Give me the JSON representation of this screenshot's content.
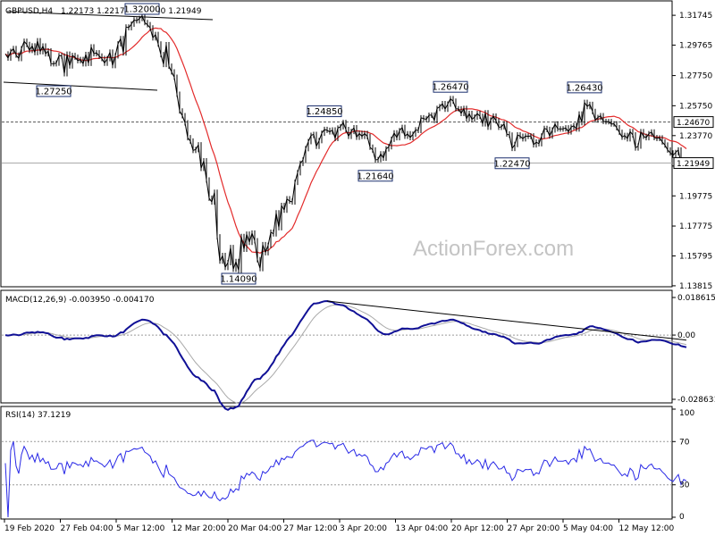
{
  "chart_data": {
    "type": "line",
    "symbol": "GBPUSD,H4",
    "ohlc_header": "1.22173 1.22177 1.21930 1.21949",
    "price_axis_ticks": [
      "1.31745",
      "1.29765",
      "1.27750",
      "1.25750",
      "1.23770",
      "1.21755",
      "1.19775",
      "1.17775",
      "1.15795",
      "1.13815"
    ],
    "price_range": [
      1.1381,
      1.3264
    ],
    "current_price": "1.21949",
    "reference_level": "1.24670",
    "x_tick_labels": [
      "19 Feb 2020",
      "27 Feb 04:00",
      "5 Mar 12:00",
      "12 Mar 20:00",
      "20 Mar 04:00",
      "27 Mar 12:00",
      "3 Apr 20:00",
      "13 Apr 04:00",
      "20 Apr 12:00",
      "27 Apr 20:00",
      "5 May 04:00",
      "12 May 12:00"
    ],
    "price_annotations": [
      "1.32000",
      "1.27250",
      "1.24850",
      "1.14090",
      "1.21640",
      "1.26470",
      "1.22470",
      "1.26430"
    ],
    "price_series": {
      "name": "GBPUSD",
      "x": [
        0,
        3,
        6,
        9,
        12,
        15,
        18,
        21,
        24,
        26,
        29,
        31,
        34,
        37,
        40,
        43,
        46,
        49,
        52,
        55,
        58,
        61,
        64,
        66,
        69,
        72,
        75,
        78,
        81,
        84,
        87,
        90,
        93,
        96,
        99,
        102,
        105,
        108,
        111,
        114,
        117,
        120,
        123,
        126,
        129,
        132,
        135,
        138,
        141,
        144,
        147,
        150,
        153,
        156,
        159,
        162,
        165,
        168,
        171,
        174,
        177,
        180,
        183,
        186,
        189,
        192,
        195,
        198,
        201,
        204,
        207,
        210,
        213,
        216,
        219,
        222,
        225,
        228,
        231,
        234,
        237,
        240,
        243,
        246,
        249,
        252,
        255,
        258,
        261,
        264,
        267,
        270,
        273,
        276,
        279,
        282,
        285,
        288,
        291,
        294,
        297,
        300,
        303,
        306,
        309,
        312,
        315,
        318,
        321,
        324,
        327,
        330,
        333,
        336,
        339,
        342,
        345,
        348,
        351,
        354,
        357,
        360,
        363,
        366,
        369,
        372,
        375,
        378,
        381,
        384,
        387,
        390,
        393,
        396,
        399,
        402,
        405,
        408,
        411,
        414,
        417,
        420,
        423,
        426,
        429,
        432,
        435,
        438,
        441,
        444,
        447,
        450,
        453,
        456,
        459,
        462,
        465,
        468,
        471,
        474,
        477,
        480,
        483,
        486,
        489,
        492,
        495,
        498,
        501,
        504,
        507,
        510,
        513,
        516,
        519,
        522,
        525,
        528,
        531,
        534,
        537,
        540,
        543,
        546,
        549,
        552,
        555,
        558,
        561,
        564,
        567,
        570,
        573,
        576,
        579,
        582,
        585,
        588,
        591,
        594,
        597,
        600,
        603,
        606,
        609,
        612,
        615,
        618,
        621,
        624,
        627,
        630,
        633,
        636,
        639,
        642,
        645,
        648,
        651,
        654,
        657,
        660,
        663,
        666,
        669,
        672,
        675,
        678,
        681,
        684,
        687,
        690,
        693,
        696,
        699,
        702,
        705,
        708,
        711,
        714,
        717,
        720,
        723,
        726,
        729,
        732,
        735,
        738,
        741
      ],
      "y": [
        1.2918,
        1.2891,
        1.2935,
        1.2954,
        1.2911,
        1.2888,
        1.2953,
        1.3002,
        1.2981,
        1.2942,
        1.2972,
        1.2927,
        1.3006,
        1.2933,
        1.2971,
        1.2919,
        1.2938,
        1.2854,
        1.2853,
        1.2858,
        1.2907,
        1.2905,
        1.2787,
        1.2917,
        1.2839,
        1.2908,
        1.2896,
        1.2874,
        1.2881,
        1.2853,
        1.2915,
        1.2856,
        1.2965,
        1.292,
        1.2926,
        1.2904,
        1.2888,
        1.2857,
        1.2887,
        1.293,
        1.2841,
        1.2906,
        1.2985,
        1.302,
        1.2925,
        1.3097,
        1.3092,
        1.3116,
        1.3144,
        1.3138,
        1.3153,
        1.3171,
        1.3126,
        1.3112,
        1.3091,
        1.3025,
        1.3047,
        1.2984,
        1.2914,
        1.2849,
        1.298,
        1.2837,
        1.2799,
        1.2764,
        1.2651,
        1.254,
        1.2509,
        1.2462,
        1.2363,
        1.2341,
        1.2279,
        1.2285,
        1.2316,
        1.216,
        1.221,
        1.2083,
        1.1962,
        1.1937,
        1.2001,
        1.1706,
        1.1545,
        1.1582,
        1.1503,
        1.1535,
        1.1635,
        1.1491,
        1.1542,
        1.1484,
        1.1708,
        1.1624,
        1.1724,
        1.167,
        1.1731,
        1.168,
        1.1555,
        1.1496,
        1.1654,
        1.1601,
        1.165,
        1.1736,
        1.1726,
        1.1865,
        1.1767,
        1.1914,
        1.1883,
        1.1958,
        1.1943,
        1.1937,
        1.2067,
        1.2131,
        1.2193,
        1.2215,
        1.2291,
        1.2337,
        1.2379,
        1.2385,
        1.2306,
        1.2344,
        1.2393,
        1.2418,
        1.2412,
        1.2402,
        1.2414,
        1.2358,
        1.2427,
        1.2436,
        1.2464,
        1.2417,
        1.2372,
        1.2405,
        1.2429,
        1.2366,
        1.2392,
        1.2372,
        1.2391,
        1.2371,
        1.23,
        1.2282,
        1.2216,
        1.2218,
        1.2256,
        1.2228,
        1.2289,
        1.2303,
        1.2353,
        1.2395,
        1.2363,
        1.241,
        1.2431,
        1.2373,
        1.2389,
        1.2364,
        1.2386,
        1.2415,
        1.2411,
        1.2495,
        1.249,
        1.2484,
        1.2512,
        1.2513,
        1.2477,
        1.2557,
        1.2569,
        1.2589,
        1.2552,
        1.2586,
        1.2622,
        1.2605,
        1.2555,
        1.2554,
        1.2524,
        1.2557,
        1.2488,
        1.2524,
        1.2485,
        1.25,
        1.2524,
        1.2505,
        1.2455,
        1.2528,
        1.2433,
        1.248,
        1.2506,
        1.2474,
        1.2432,
        1.2435,
        1.2456,
        1.2388,
        1.238,
        1.2292,
        1.2318,
        1.2382,
        1.2373,
        1.2356,
        1.2374,
        1.2372,
        1.2375,
        1.2316,
        1.2334,
        1.2323,
        1.2374,
        1.2425,
        1.2418,
        1.2374,
        1.2414,
        1.2454,
        1.2422,
        1.2421,
        1.2422,
        1.2428,
        1.2402,
        1.2433,
        1.2443,
        1.2421,
        1.252,
        1.2463,
        1.2597,
        1.257,
        1.2584,
        1.2537,
        1.2481,
        1.2497,
        1.2509,
        1.2471,
        1.2469,
        1.247,
        1.2454,
        1.2455,
        1.2429,
        1.2399,
        1.2367,
        1.2378,
        1.2356,
        1.2404,
        1.2382,
        1.2295,
        1.2308,
        1.2403,
        1.2372,
        1.2363,
        1.239,
        1.2401,
        1.2364,
        1.2358,
        1.2362,
        1.2335,
        1.2314,
        1.2282,
        1.2262,
        1.2247,
        1.2265,
        1.2282,
        1.2182,
        1.2211,
        1.2195
      ]
    },
    "macd_label": "MACD(12,26,9) -0.003950 -0.004170",
    "macd_axis_ticks": [
      "0.018615",
      "0.00",
      "-0.028631"
    ],
    "macd_range": [
      -0.028631,
      0.018615
    ],
    "rsi_label": "RSI(14) 37.1219",
    "rsi_axis_ticks": [
      "100",
      "70",
      "30",
      "0"
    ],
    "rsi_range": [
      0,
      100
    ],
    "rsi_levels": [
      30,
      70
    ],
    "watermark": "ActionForex.com",
    "colors": {
      "price_line": "#000000",
      "moving_average": "#e32b2b",
      "macd_main": "#101096",
      "macd_signal": "#a9a9a9",
      "rsi_line": "#2828e6",
      "annotation_box_border": "#1b2f6e",
      "grid_dash": "#9a9a9a"
    }
  }
}
